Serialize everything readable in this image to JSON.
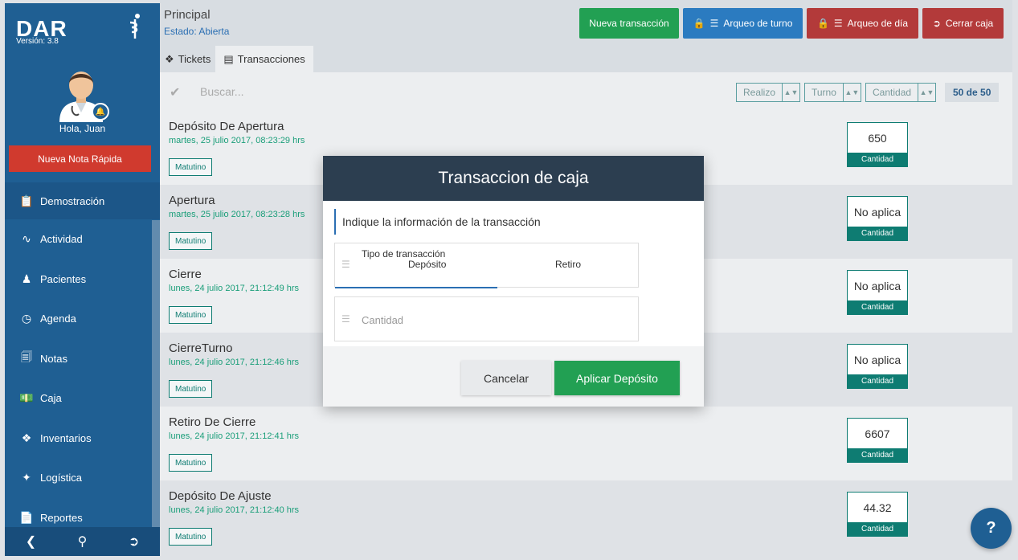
{
  "sidebar": {
    "brand": "DAR",
    "version": "Versión: 3.8",
    "greeting": "Hola, Juan",
    "quick_note": "Nueva Nota Rápida",
    "items": [
      {
        "label": "Demostración",
        "icon": "clipboard-icon"
      },
      {
        "label": "Actividad",
        "icon": "pulse-icon"
      },
      {
        "label": "Pacientes",
        "icon": "user-icon"
      },
      {
        "label": "Agenda",
        "icon": "clock-icon"
      },
      {
        "label": "Notas",
        "icon": "notes-icon"
      },
      {
        "label": "Caja",
        "icon": "cash-icon"
      },
      {
        "label": "Inventarios",
        "icon": "dropbox-icon"
      },
      {
        "label": "Logística",
        "icon": "wand-icon"
      },
      {
        "label": "Reportes",
        "icon": "file-icon"
      }
    ]
  },
  "header": {
    "title": "Principal",
    "state": "Estado: Abierta",
    "buttons": {
      "new_transaction": "Nueva transacción",
      "shift_count": "Arqueo de turno",
      "day_count": "Arqueo de día",
      "close_register": "Cerrar caja"
    },
    "tabs": [
      "Tickets",
      "Transacciones"
    ]
  },
  "filters": {
    "search_placeholder": "Buscar...",
    "realizo": "Realizo",
    "turno": "Turno",
    "cantidad": "Cantidad",
    "count": "50 de 50"
  },
  "rows": [
    {
      "title": "Depósito De Apertura",
      "date": "martes, 25 julio 2017, 08:23:29 hrs",
      "shift": "Matutino",
      "amount": "650",
      "amount_label": "Cantidad"
    },
    {
      "title": "Apertura",
      "date": "martes, 25 julio 2017, 08:23:28 hrs",
      "shift": "Matutino",
      "amount": "No aplica",
      "amount_label": "Cantidad"
    },
    {
      "title": "Cierre",
      "date": "lunes, 24 julio 2017, 21:12:49 hrs",
      "shift": "Matutino",
      "amount": "No aplica",
      "amount_label": "Cantidad"
    },
    {
      "title": "CierreTurno",
      "date": "lunes, 24 julio 2017, 21:12:46 hrs",
      "shift": "Matutino",
      "amount": "No aplica",
      "amount_label": "Cantidad"
    },
    {
      "title": "Retiro De Cierre",
      "date": "lunes, 24 julio 2017, 21:12:41 hrs",
      "shift": "Matutino",
      "amount": "6607",
      "amount_label": "Cantidad"
    },
    {
      "title": "Depósito De Ajuste",
      "date": "lunes, 24 julio 2017, 21:12:40 hrs",
      "shift": "Matutino",
      "amount": "44.32",
      "amount_label": "Cantidad"
    }
  ],
  "modal": {
    "title": "Transaccion de caja",
    "info": "Indique la información de la transacción",
    "type_label": "Tipo de transacción",
    "option_deposit": "Depósito",
    "option_withdraw": "Retiro",
    "quantity_placeholder": "Cantidad",
    "cancel": "Cancelar",
    "apply": "Aplicar Depósito"
  },
  "help": "?",
  "colors": {
    "sidebar": "#1f5f93",
    "green": "#22a053",
    "blue": "#2b7bc0",
    "red": "#b33a3a",
    "teal": "#0e7c72"
  }
}
